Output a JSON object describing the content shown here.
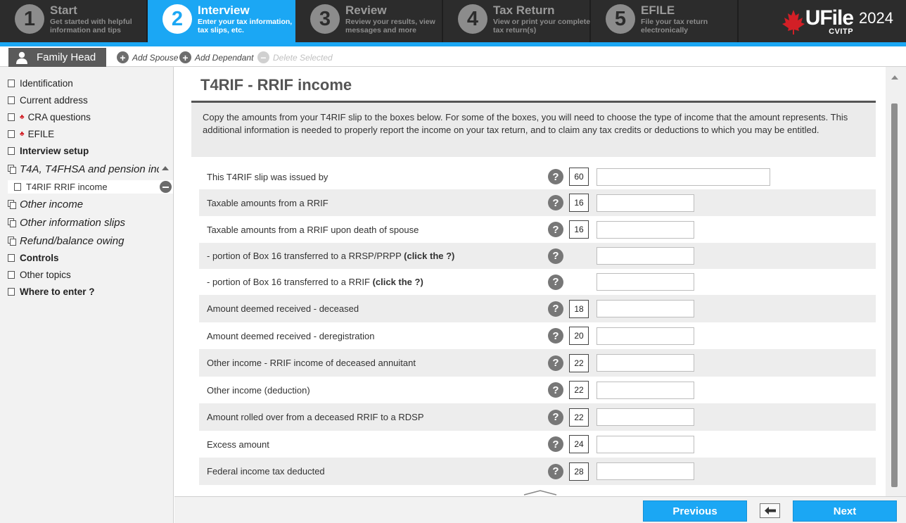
{
  "steps": [
    {
      "num": "1",
      "title": "Start",
      "desc": "Get started with helpful information and tips"
    },
    {
      "num": "2",
      "title": "Interview",
      "desc": "Enter your tax information, tax slips, etc."
    },
    {
      "num": "3",
      "title": "Review",
      "desc": "Review your results, view messages and more"
    },
    {
      "num": "4",
      "title": "Tax Return",
      "desc": "View or print your complete tax return(s)"
    },
    {
      "num": "5",
      "title": "EFILE",
      "desc": "File your tax return electronically"
    }
  ],
  "logo": {
    "word": "UFile",
    "sub": "CVITP",
    "year": "2024"
  },
  "family": {
    "tab_label": "Family Head",
    "add_spouse": "Add Spouse",
    "add_dependant": "Add Dependant",
    "delete_selected": "Delete Selected"
  },
  "sidebar": {
    "identification": "Identification",
    "current_address": "Current address",
    "cra_questions": "CRA questions",
    "efile": "EFILE",
    "interview_setup": "Interview setup",
    "t4a_group": "T4A, T4FHSA and pension inc",
    "t4rif": "T4RIF RRIF income",
    "other_income": "Other income",
    "other_info_slips": "Other information slips",
    "refund": "Refund/balance owing",
    "controls": "Controls",
    "other_topics": "Other topics",
    "where_to_enter": "Where to enter ?"
  },
  "form": {
    "title": "T4RIF - RRIF income",
    "info": "Copy the amounts from your T4RIF slip to the boxes below. For some of the boxes, you will need to choose the type of income that the amount represents. This additional information is needed to properly report the income on your tax return, and to claim any tax credits or deductions to which you may be entitled.",
    "help_glyph": "?",
    "rows": [
      {
        "label": "This T4RIF slip was issued by",
        "box": "60",
        "value": ""
      },
      {
        "label": "Taxable amounts from a RRIF",
        "box": "16",
        "value": ""
      },
      {
        "label": "Taxable amounts from a RRIF upon death of spouse",
        "box": "16",
        "value": ""
      },
      {
        "label": "- portion of Box 16 transferred to a RRSP/PRPP",
        "bold": "(click the ?)",
        "box": "",
        "value": ""
      },
      {
        "label": "- portion of Box 16 transferred to a RRIF",
        "bold": "(click the ?)",
        "box": "",
        "value": ""
      },
      {
        "label": "Amount deemed received - deceased",
        "box": "18",
        "value": ""
      },
      {
        "label": "Amount deemed received - deregistration",
        "box": "20",
        "value": ""
      },
      {
        "label": "Other income - RRIF income of deceased annuitant",
        "box": "22",
        "value": ""
      },
      {
        "label": "Other income (deduction)",
        "box": "22",
        "value": ""
      },
      {
        "label": "Amount rolled over from a deceased RRIF to a RDSP",
        "box": "22",
        "value": ""
      },
      {
        "label": "Excess amount",
        "box": "24",
        "value": ""
      },
      {
        "label": "Federal income tax deducted",
        "box": "28",
        "value": ""
      }
    ]
  },
  "buttons": {
    "previous": "Previous",
    "next": "Next"
  },
  "colors": {
    "accent": "#1ba7f4",
    "topbar": "#2c2c2c",
    "maple": "#d21f26"
  },
  "icons": {
    "person": "person-icon",
    "plus": "plus-circle-icon",
    "minus": "minus-circle-icon",
    "help": "question-circle-icon",
    "back": "back-arrow-icon",
    "maple": "maple-leaf-icon"
  }
}
